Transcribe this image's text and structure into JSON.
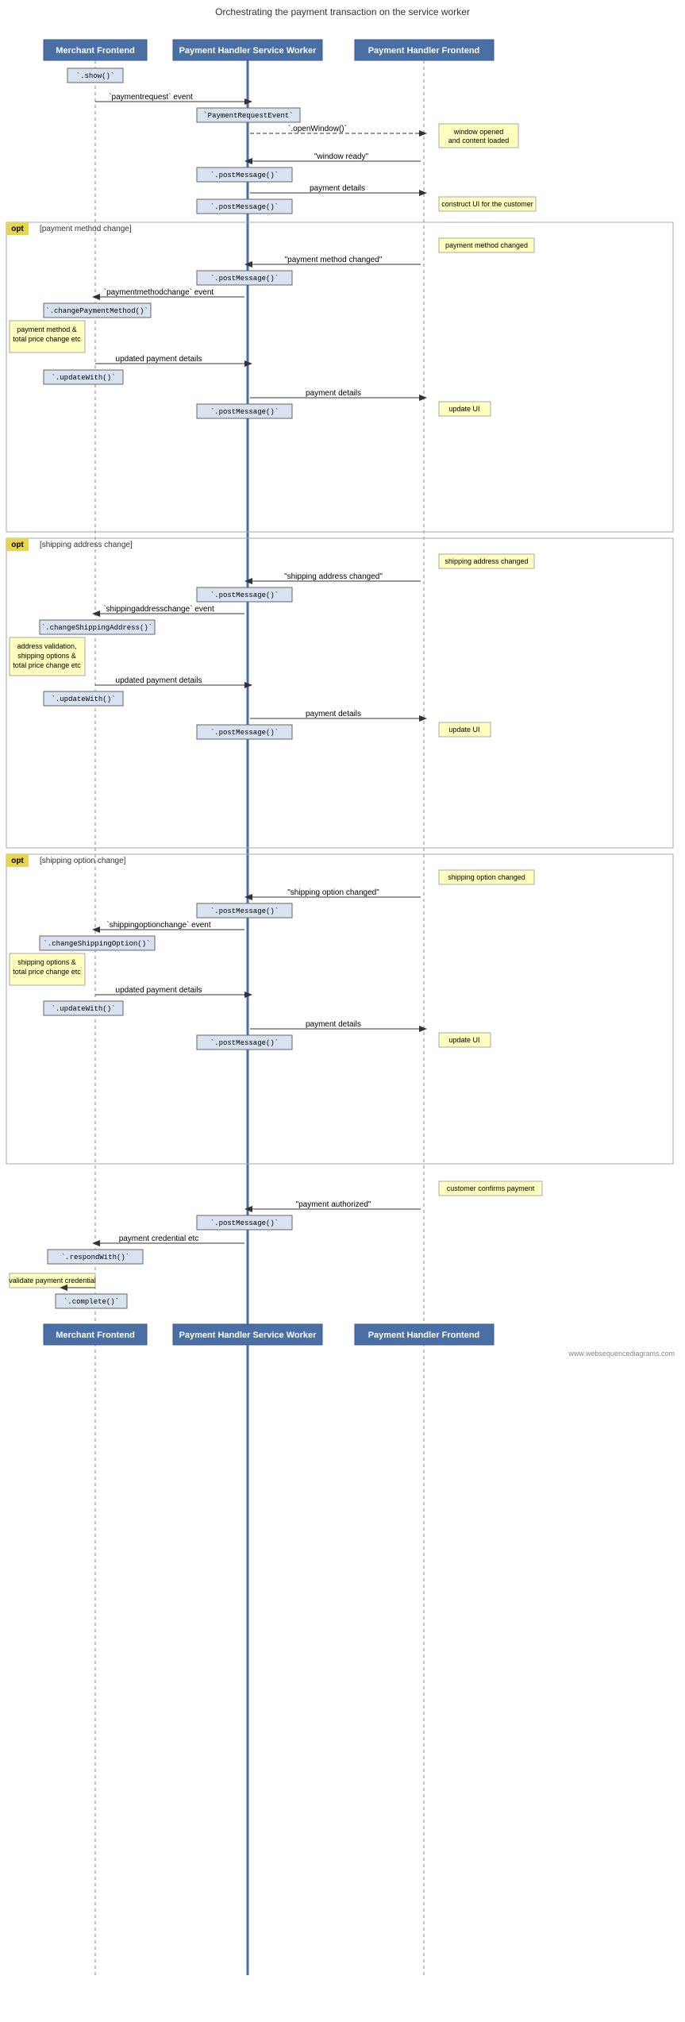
{
  "title": "Orchestrating the payment transaction on the service worker",
  "actors": {
    "merchant": "Merchant Frontend",
    "sw": "Payment Handler Service Worker",
    "frontend": "Payment Handler Frontend"
  },
  "footer_note": "www.websequencediagrams.com",
  "fragments": [
    {
      "label": "opt",
      "description": "[payment method change]"
    },
    {
      "label": "opt",
      "description": "[shipping address change]"
    },
    {
      "label": "opt",
      "description": "[shipping option change]"
    }
  ],
  "notes": {
    "window_opened": "window opened\nand content loaded",
    "construct_ui": "construct UI for the customer",
    "payment_method_changed_note": "payment method changed",
    "payment_method_total": "payment method &\ntotal price change etc",
    "update_ui_1": "update UI",
    "shipping_address_changed_note": "shipping address changed",
    "address_validation": "address validation,\nshipping options &\ntotal price change etc",
    "update_ui_2": "update UI",
    "shipping_option_changed_note": "shipping option changed",
    "shipping_options": "shipping options &\ntotal price change etc",
    "update_ui_3": "update UI",
    "customer_confirms": "customer confirms payment",
    "validate_payment": "validate payment credential"
  },
  "messages": [
    "`.show()`",
    "`paymentrequest` event",
    "`PaymentRequestEvent`",
    "`.openWindow()`",
    "\"window ready\"",
    "`.postMessage()`",
    "payment details",
    "`.postMessage()`",
    "\"payment method changed\"",
    "`.postMessage()`",
    "`paymentmethodchange` event",
    "`.changePaymentMethod()`",
    "updated payment details",
    "`.updateWith()`",
    "payment details",
    "`.postMessage()`",
    "\"shipping address changed\"",
    "`.postMessage()`",
    "`shippingaddresschange` event",
    "`.changeShippingAddress()`",
    "updated payment details",
    "`.updateWith()`",
    "payment details",
    "`.postMessage()`",
    "\"shipping option changed\"",
    "`.postMessage()`",
    "`shippingoptionchange` event",
    "`.changeShippingOption()`",
    "updated payment details",
    "`.updateWith()`",
    "payment details",
    "`.postMessage()`",
    "\"payment authorized\"",
    "`.postMessage()`",
    "payment credential etc",
    "`.respondWith()`",
    "`.complete()`"
  ]
}
